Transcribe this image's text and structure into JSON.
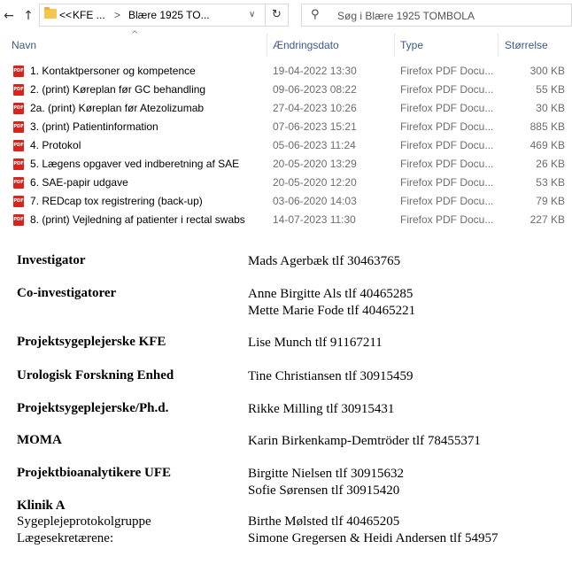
{
  "explorer": {
    "breadcrumb": {
      "chevrons": "<<",
      "segment1": "KFE ...",
      "separator": ">",
      "segment2": "Blære 1925 TO..."
    },
    "search_placeholder": "Søg i Blære 1925 TOMBOLA",
    "nav": {
      "back": "←",
      "forward": "→",
      "dropdown": "∨",
      "up": "↑",
      "refresh": "↻",
      "search_icon": "⚲"
    },
    "columns": {
      "name": "Navn",
      "date": "Ændringsdato",
      "type": "Type",
      "size": "Størrelse"
    },
    "files": [
      {
        "name": "1. Kontaktpersoner og kompetence",
        "date": "19-04-2022 13:30",
        "type": "Firefox PDF Docu...",
        "size": "300 KB"
      },
      {
        "name": "2. (print) Køreplan før GC behandling",
        "date": "09-06-2023 08:22",
        "type": "Firefox PDF Docu...",
        "size": "55 KB"
      },
      {
        "name": "2a. (print) Køreplan før Atezolizumab",
        "date": "27-04-2023 10:26",
        "type": "Firefox PDF Docu...",
        "size": "30 KB"
      },
      {
        "name": "3. (print) Patientinformation",
        "date": "07-06-2023 15:21",
        "type": "Firefox PDF Docu...",
        "size": "885 KB"
      },
      {
        "name": "4. Protokol",
        "date": "05-06-2023 11:24",
        "type": "Firefox PDF Docu...",
        "size": "469 KB"
      },
      {
        "name": "5. Lægens opgaver ved indberetning af SAE",
        "date": "20-05-2020 13:29",
        "type": "Firefox PDF Docu...",
        "size": "26 KB"
      },
      {
        "name": "6. SAE-papir udgave",
        "date": "20-05-2020 12:20",
        "type": "Firefox PDF Docu...",
        "size": "53 KB"
      },
      {
        "name": "7. REDcap tox registrering (back-up)",
        "date": "03-06-2020 14:03",
        "type": "Firefox PDF Docu...",
        "size": "79 KB"
      },
      {
        "name": "8. (print) Vejledning af patienter i rectal swabs",
        "date": "14-07-2023 11:30",
        "type": "Firefox PDF Docu...",
        "size": "227 KB"
      }
    ]
  },
  "contacts": [
    {
      "role": "Investigator",
      "lines": [
        "Mads Agerbæk tlf  30463765"
      ]
    },
    {
      "role": "Co-investigatorer",
      "lines": [
        "Anne Birgitte  Als tlf  40465285",
        "Mette Marie Fode tlf  40465221"
      ]
    },
    {
      "role": "Projektsygeplejerske KFE",
      "lines": [
        "Lise  Munch tlf  91167211"
      ]
    },
    {
      "role": "Urologisk  Forskning  Enhed",
      "lines": [
        "Tine  Christiansen  tlf  30915459"
      ]
    },
    {
      "role": "Projektsygeplejerske/Ph.d.",
      "lines": [
        "Rikke  Milling  tlf  30915431"
      ]
    },
    {
      "role": "MOMA",
      "lines": [
        "Karin Birkenkamp-Demtröder  tlf  78455371"
      ]
    },
    {
      "role": "Projektbioanalytikere  UFE",
      "lines": [
        "Birgitte  Nielsen tlf  30915632",
        "Sofie Sørensen tlf  30915420"
      ]
    }
  ],
  "klinik": {
    "title": "Klinik  A",
    "items": [
      {
        "label": "Sygeplejeprotokolgruppe",
        "value": "Birthe  Mølsted tlf  40465205"
      },
      {
        "label": "Lægesekretærene:",
        "value": "Simone  Gregersen  & Heidi Andersen  tlf  54957"
      }
    ]
  }
}
